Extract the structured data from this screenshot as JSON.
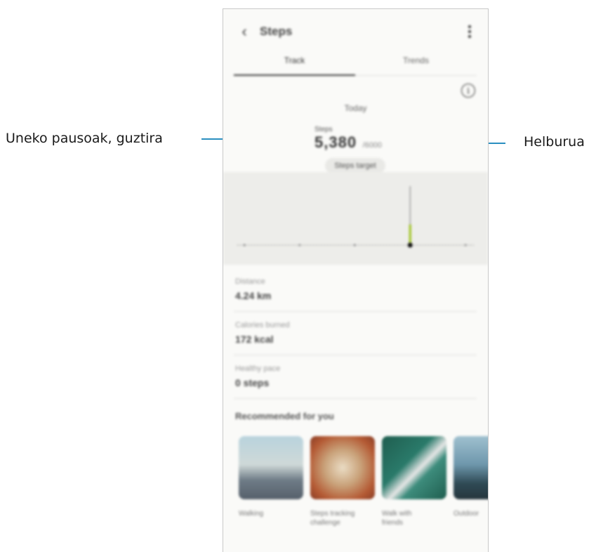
{
  "callouts": {
    "left_label": "Uneko pausoak, guztira",
    "right_label": "Helburua"
  },
  "app": {
    "title": "Steps",
    "tabs": [
      {
        "label": "Track",
        "active": true
      },
      {
        "label": "Trends",
        "active": false
      }
    ]
  },
  "summary": {
    "period": "Today",
    "steps_label": "Steps",
    "steps_value": "5,380",
    "goal_text": "/6000",
    "goal_button": "Steps target"
  },
  "chart_data": {
    "type": "line",
    "x": [
      "",
      "",
      "",
      "",
      ""
    ],
    "values": [
      0,
      0,
      0,
      5380,
      0
    ],
    "highlight_index": 3,
    "accent_color": "#9cc21a"
  },
  "stats": [
    {
      "label": "Distance",
      "value": "4.24 km"
    },
    {
      "label": "Calories burned",
      "value": "172 kcal"
    },
    {
      "label": "Healthy pace",
      "value": "0 steps"
    }
  ],
  "recommended": {
    "title": "Recommended for you",
    "cards": [
      {
        "title": "Walking",
        "subtitle": "",
        "color_a": "#b9d3dd",
        "color_b": "#6e7b86"
      },
      {
        "title": "Steps tracking",
        "subtitle": "challenge",
        "color_a": "#c96a3a",
        "color_b": "#eadcc4"
      },
      {
        "title": "Walk with",
        "subtitle": "friends",
        "color_a": "#2a7a6a",
        "color_b": "#55aa99"
      },
      {
        "title": "Outdoor",
        "subtitle": "",
        "color_a": "#6e97ac",
        "color_b": "#2f4a55"
      }
    ]
  }
}
